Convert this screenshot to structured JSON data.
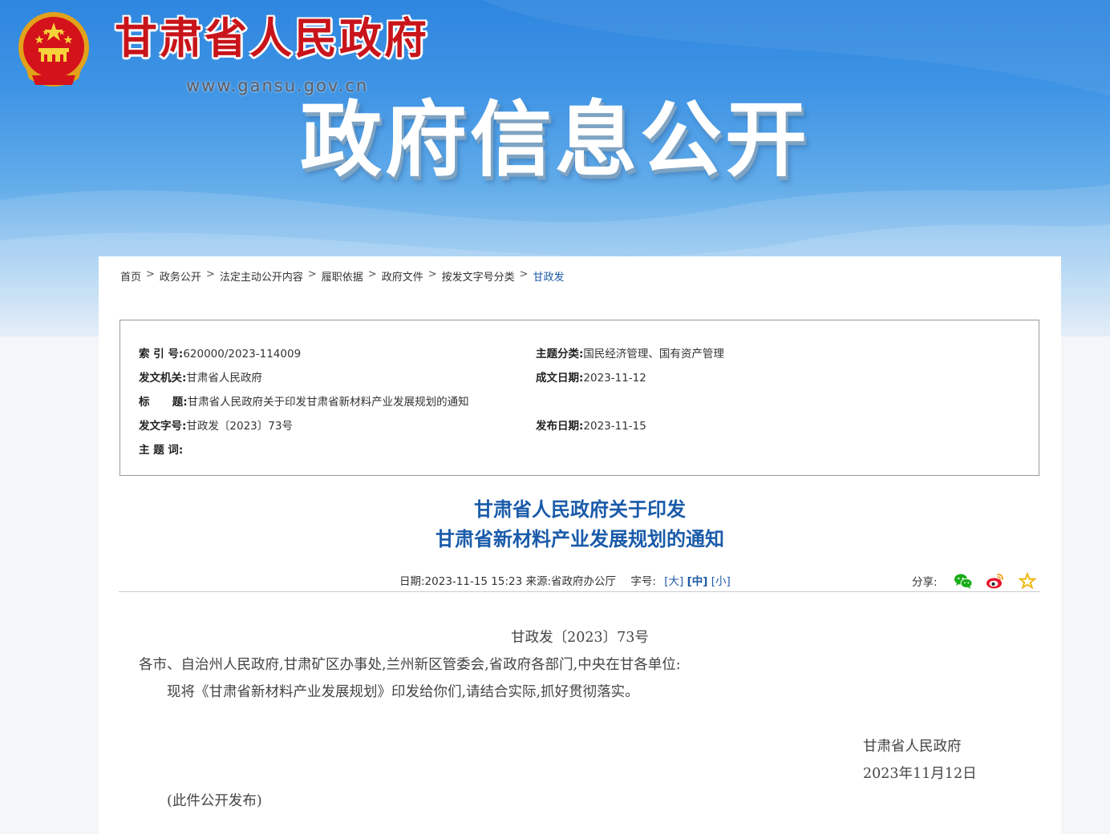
{
  "header": {
    "site_title": "甘肃省人民政府",
    "site_url": "www.gansu.gov.cn",
    "banner_title": "政府信息公开"
  },
  "breadcrumb": [
    "首页",
    "政务公开",
    "法定主动公开内容",
    "履职依据",
    "政府文件",
    "按发文字号分类",
    "甘政发"
  ],
  "meta": {
    "index_label": "索 引 号:",
    "index_value": "620000/2023-114009",
    "topic_label": "主题分类:",
    "topic_value": "国民经济管理、国有资产管理",
    "issuer_label": "发文机关:",
    "issuer_value": "甘肃省人民政府",
    "created_label": "成文日期:",
    "created_value": "2023-11-12",
    "title_label": "标      题:",
    "title_value": "甘肃省人民政府关于印发甘肃省新材料产业发展规划的通知",
    "docno_label": "发文字号:",
    "docno_value": "甘政发〔2023〕73号",
    "published_label": "发布日期:",
    "published_value": "2023-11-15",
    "keywords_label": "主 题 词:",
    "keywords_value": ""
  },
  "article": {
    "title_line1": "甘肃省人民政府关于印发",
    "title_line2": "甘肃省新材料产业发展规划的通知",
    "date_text": "日期:2023-11-15 15:23 来源:",
    "source": "省政府办公厅",
    "font_size_label": "字号:",
    "size_large": "大",
    "size_medium": "中",
    "size_small": "小",
    "share_label": "分享:"
  },
  "document": {
    "doc_number": "甘政发〔2023〕73号",
    "addressee": "各市、自治州人民政府,甘肃矿区办事处,兰州新区管委会,省政府各部门,中央在甘各单位:",
    "body": "现将《甘肃省新材料产业发展规划》印发给你们,请结合实际,抓好贯彻落实。",
    "signature": "甘肃省人民政府",
    "sign_date": "2023年11月12日",
    "note": "(此件公开发布)"
  },
  "icons": [
    "national-emblem-icon",
    "wechat-icon",
    "weibo-icon",
    "favorite-star-icon"
  ],
  "colors": {
    "title_red": "#c8141a",
    "link_blue": "#1d5aa7",
    "article_title_blue": "#1a5baa"
  }
}
